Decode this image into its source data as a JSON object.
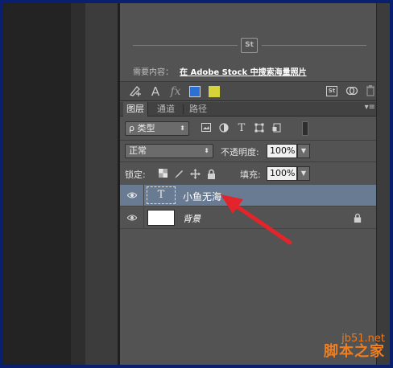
{
  "stock": {
    "badge": "St",
    "prefix": "需要内容：",
    "link": "在 Adobe Stock 中搜索海量照片"
  },
  "toolbar": {
    "text_tool": "A",
    "fx_label": "fx",
    "st_label": "St",
    "swatch_blue": "#2d6fd2",
    "swatch_yellow": "#d6d43a"
  },
  "tabs": [
    "图层",
    "通道",
    "路径"
  ],
  "filter": {
    "kind_label": "ρ 类型",
    "text_icon": "T"
  },
  "blend": {
    "mode": "正常",
    "opacity_label": "不透明度:",
    "opacity_value": "100%"
  },
  "lock": {
    "label": "锁定:",
    "fill_label": "填充:",
    "fill_value": "100%"
  },
  "layers": [
    {
      "name": "小鱼无海",
      "type": "text",
      "thumb": "T",
      "selected": true
    },
    {
      "name": "背景",
      "type": "background",
      "selected": false
    }
  ],
  "watermark": {
    "site": "jb51.net",
    "brand": "脚本之家"
  },
  "colors": {
    "selected_layer": "#697b93",
    "annotation_arrow": "#e3242b",
    "border": "#0b1f6f"
  }
}
